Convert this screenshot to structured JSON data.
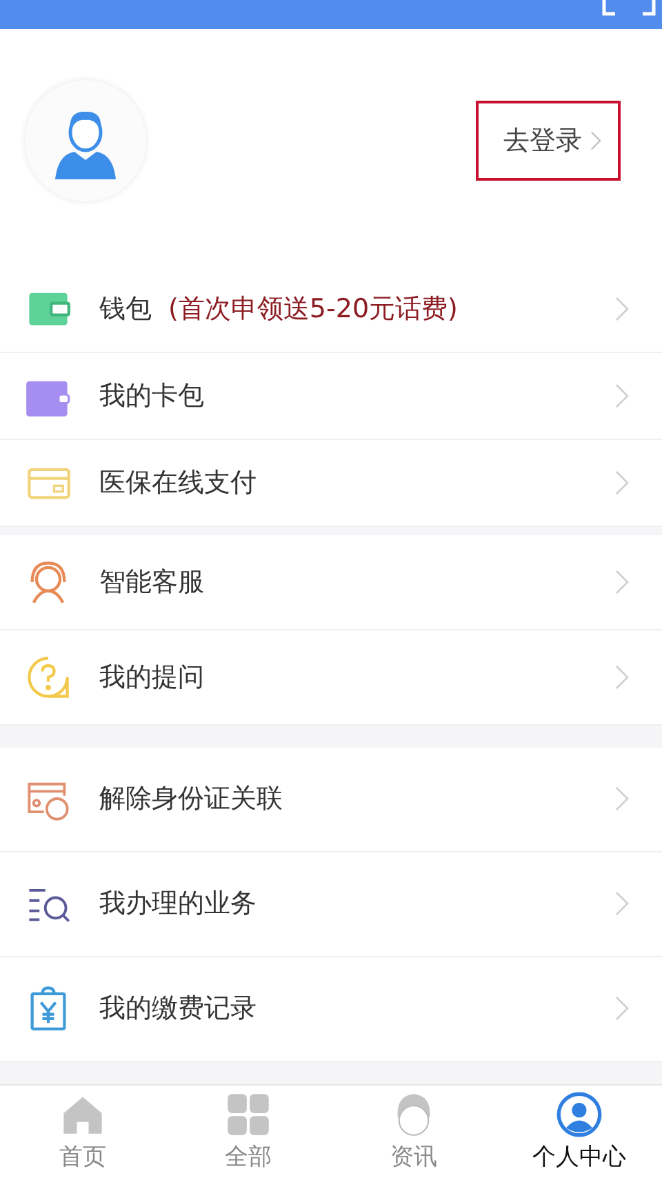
{
  "header": {
    "login": "去登录"
  },
  "menu_groups": [
    {
      "items": [
        {
          "kind": "wallet",
          "label": "钱包",
          "note": "(首次申领送5-20元话费)"
        },
        {
          "kind": "cardbag",
          "label": "我的卡包"
        },
        {
          "kind": "card",
          "label": "医保在线支付"
        }
      ]
    },
    {
      "items": [
        {
          "kind": "service",
          "label": "智能客服"
        },
        {
          "kind": "question",
          "label": "我的提问"
        }
      ]
    },
    {
      "items": [
        {
          "kind": "idcard",
          "label": "解除身份证关联"
        },
        {
          "kind": "search",
          "label": "我办理的业务"
        },
        {
          "kind": "receipt",
          "label": "我的缴费记录"
        }
      ]
    }
  ],
  "tabs": [
    {
      "kind": "home",
      "label": "首页",
      "selected": false
    },
    {
      "kind": "all",
      "label": "全部",
      "selected": false
    },
    {
      "kind": "news",
      "label": "资讯",
      "selected": false
    },
    {
      "kind": "me",
      "label": "个人中心",
      "selected": true
    }
  ]
}
